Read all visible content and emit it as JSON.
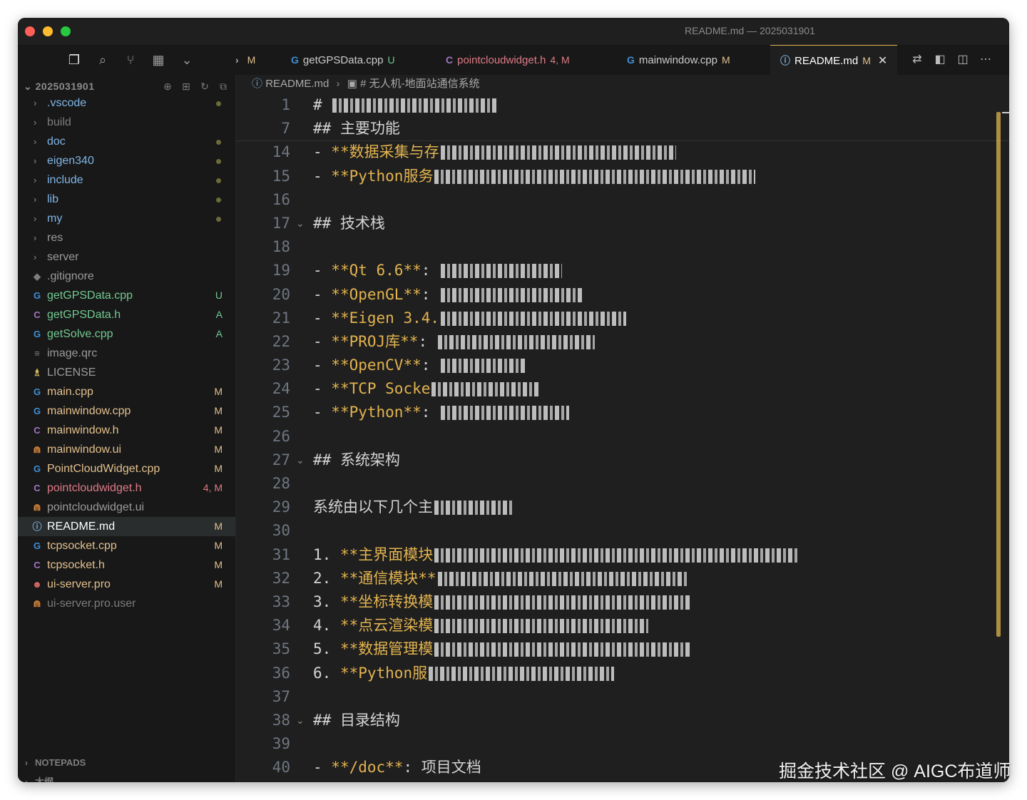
{
  "window": {
    "title": "README.md — 2025031901"
  },
  "activity": {
    "icons": [
      "files-icon",
      "search-icon",
      "source-control-icon",
      "extensions-icon",
      "chevron-down-icon"
    ]
  },
  "tabs": [
    {
      "label": "",
      "status": "M",
      "icon": "›"
    },
    {
      "label": "getGPSData.cpp",
      "status": "U",
      "icon": "G"
    },
    {
      "label": "pointcloudwidget.h",
      "status": "4, M",
      "icon": "C"
    },
    {
      "label": "mainwindow.cpp",
      "status": "M",
      "icon": "G"
    },
    {
      "label": "README.md",
      "status": "M",
      "icon": "ⓘ"
    }
  ],
  "tab_close_glyph": "✕",
  "explorer": {
    "root": "2025031901",
    "items": [
      {
        "name": ".vscode",
        "kind": "folder",
        "badge": "",
        "dot": true
      },
      {
        "name": "build",
        "kind": "folder",
        "badge": "",
        "dot": false,
        "dim": true
      },
      {
        "name": "doc",
        "kind": "folder",
        "badge": "",
        "dot": true
      },
      {
        "name": "eigen340",
        "kind": "folder",
        "badge": "",
        "dot": true
      },
      {
        "name": "include",
        "kind": "folder",
        "badge": "",
        "dot": true
      },
      {
        "name": "lib",
        "kind": "folder",
        "badge": "",
        "dot": true
      },
      {
        "name": "my",
        "kind": "folder",
        "badge": "",
        "dot": true
      },
      {
        "name": "res",
        "kind": "folder",
        "badge": "",
        "dot": false
      },
      {
        "name": "server",
        "kind": "folder",
        "badge": "",
        "dot": false
      },
      {
        "name": ".gitignore",
        "kind": "git",
        "badge": ""
      },
      {
        "name": "getGPSData.cpp",
        "kind": "cpp",
        "badge": "U"
      },
      {
        "name": "getGPSData.h",
        "kind": "h",
        "badge": "A"
      },
      {
        "name": "getSolve.cpp",
        "kind": "cpp",
        "badge": "A"
      },
      {
        "name": "image.qrc",
        "kind": "qrc",
        "badge": ""
      },
      {
        "name": "LICENSE",
        "kind": "license",
        "badge": ""
      },
      {
        "name": "main.cpp",
        "kind": "cpp",
        "badge": "M"
      },
      {
        "name": "mainwindow.cpp",
        "kind": "cpp",
        "badge": "M"
      },
      {
        "name": "mainwindow.h",
        "kind": "h",
        "badge": "M"
      },
      {
        "name": "mainwindow.ui",
        "kind": "ui",
        "badge": "M"
      },
      {
        "name": "PointCloudWidget.cpp",
        "kind": "cpp",
        "badge": "M"
      },
      {
        "name": "pointcloudwidget.h",
        "kind": "h",
        "badge": "4, M",
        "error": true
      },
      {
        "name": "pointcloudwidget.ui",
        "kind": "ui",
        "badge": ""
      },
      {
        "name": "README.md",
        "kind": "info",
        "badge": "M",
        "selected": true
      },
      {
        "name": "tcpsocket.cpp",
        "kind": "cpp",
        "badge": "M"
      },
      {
        "name": "tcpsocket.h",
        "kind": "h",
        "badge": "M"
      },
      {
        "name": "ui-server.pro",
        "kind": "pro",
        "badge": "M"
      },
      {
        "name": "ui-server.pro.user",
        "kind": "ui",
        "badge": "",
        "dim": true
      }
    ],
    "footer": [
      "NOTEPADS",
      "大纲"
    ]
  },
  "breadcrumb": {
    "file": "README.md",
    "section": "# 无人机-地面站通信系统"
  },
  "editor_lines": [
    {
      "n": "1",
      "pre": "# ",
      "bold": "",
      "text": "",
      "blur": 230
    },
    {
      "n": "7",
      "pre": "## ",
      "bold": "",
      "text": "主要功能",
      "blur": 0
    },
    {
      "n": "14",
      "pre": "- ",
      "bold": "**数据采集与存",
      "text": "",
      "blur": 330
    },
    {
      "n": "15",
      "pre": "- ",
      "bold": "**Python服务",
      "text": "",
      "blur": 450
    },
    {
      "n": "16",
      "pre": "",
      "bold": "",
      "text": "",
      "blur": 0
    },
    {
      "n": "17",
      "pre": "## ",
      "bold": "",
      "text": "技术栈",
      "blur": 0,
      "fold": true
    },
    {
      "n": "18",
      "pre": "",
      "bold": "",
      "text": "",
      "blur": 0
    },
    {
      "n": "19",
      "pre": "- ",
      "bold": "**Qt 6.6**",
      "text": ": ",
      "blur": 170
    },
    {
      "n": "20",
      "pre": "- ",
      "bold": "**OpenGL**",
      "text": ": ",
      "blur": 200
    },
    {
      "n": "21",
      "pre": "- ",
      "bold": "**Eigen 3.4.",
      "text": "",
      "blur": 260
    },
    {
      "n": "22",
      "pre": "- ",
      "bold": "**PROJ库**",
      "text": ": ",
      "blur": 220
    },
    {
      "n": "23",
      "pre": "- ",
      "bold": "**OpenCV**",
      "text": ": ",
      "blur": 120
    },
    {
      "n": "24",
      "pre": "- ",
      "bold": "**TCP Socke",
      "text": "",
      "blur": 150
    },
    {
      "n": "25",
      "pre": "- ",
      "bold": "**Python**",
      "text": ": ",
      "blur": 180
    },
    {
      "n": "26",
      "pre": "",
      "bold": "",
      "text": "",
      "blur": 0
    },
    {
      "n": "27",
      "pre": "## ",
      "bold": "",
      "text": "系统架构",
      "blur": 0,
      "fold": true
    },
    {
      "n": "28",
      "pre": "",
      "bold": "",
      "text": "",
      "blur": 0
    },
    {
      "n": "29",
      "pre": "",
      "bold": "",
      "text": "系统由以下几个主",
      "blur": 110
    },
    {
      "n": "30",
      "pre": "",
      "bold": "",
      "text": "",
      "blur": 0
    },
    {
      "n": "31",
      "pre": "1. ",
      "bold": "**主界面模块",
      "text": "",
      "blur": 510
    },
    {
      "n": "32",
      "pre": "2. ",
      "bold": "**通信模块**",
      "text": "",
      "blur": 350
    },
    {
      "n": "33",
      "pre": "3. ",
      "bold": "**坐标转换模",
      "text": "",
      "blur": 360
    },
    {
      "n": "34",
      "pre": "4. ",
      "bold": "**点云渲染模",
      "text": "",
      "blur": 300
    },
    {
      "n": "35",
      "pre": "5. ",
      "bold": "**数据管理模",
      "text": "",
      "blur": 360
    },
    {
      "n": "36",
      "pre": "6. ",
      "bold": "**Python服",
      "text": "",
      "blur": 260
    },
    {
      "n": "37",
      "pre": "",
      "bold": "",
      "text": "",
      "blur": 0
    },
    {
      "n": "38",
      "pre": "## ",
      "bold": "",
      "text": "目录结构",
      "blur": 0,
      "fold": true
    },
    {
      "n": "39",
      "pre": "",
      "bold": "",
      "text": "",
      "blur": 0
    },
    {
      "n": "40",
      "pre": "- ",
      "bold": "**/doc**",
      "text": ": 项目文档",
      "blur": 0
    }
  ],
  "watermark": "掘金技术社区 @ AIGC布道师"
}
